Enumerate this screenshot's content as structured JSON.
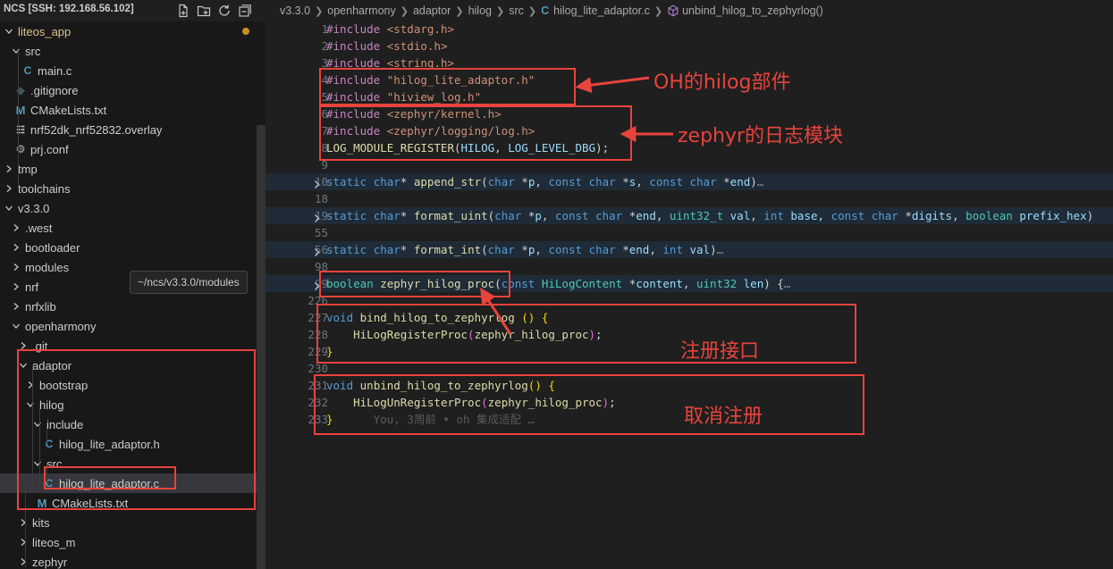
{
  "sidebar": {
    "title": "NCS [SSH: 192.168.56.102]",
    "header_icons": [
      "new-file-icon",
      "new-folder-icon",
      "refresh-icon",
      "collapse-all-icon"
    ],
    "tooltip": "~/ncs/v3.3.0/modules",
    "tree": [
      {
        "label": "liteos_app",
        "kind": "folder",
        "open": true,
        "modified": true
      },
      {
        "label": "src",
        "kind": "folder",
        "open": true
      },
      {
        "label": "main.c",
        "kind": "c"
      },
      {
        "label": ".gitignore",
        "kind": "dot"
      },
      {
        "label": "CMakeLists.txt",
        "kind": "m"
      },
      {
        "label": "nrf52dk_nrf52832.overlay",
        "kind": "brace"
      },
      {
        "label": "prj.conf",
        "kind": "gear"
      },
      {
        "label": "tmp",
        "kind": "folder",
        "open": false
      },
      {
        "label": "toolchains",
        "kind": "folder",
        "open": false
      },
      {
        "label": "v3.3.0",
        "kind": "folder",
        "open": true
      },
      {
        "label": ".west",
        "kind": "folder",
        "open": false
      },
      {
        "label": "bootloader",
        "kind": "folder",
        "open": false
      },
      {
        "label": "modules",
        "kind": "folder",
        "open": false
      },
      {
        "label": "nrf",
        "kind": "folder",
        "open": false
      },
      {
        "label": "nrfxlib",
        "kind": "folder",
        "open": false
      },
      {
        "label": "openharmony",
        "kind": "folder",
        "open": true
      },
      {
        "label": ".git",
        "kind": "folder",
        "open": false
      },
      {
        "label": "adaptor",
        "kind": "folder",
        "open": true
      },
      {
        "label": "bootstrap",
        "kind": "folder",
        "open": false
      },
      {
        "label": "hilog",
        "kind": "folder",
        "open": true
      },
      {
        "label": "include",
        "kind": "folder",
        "open": true
      },
      {
        "label": "hilog_lite_adaptor.h",
        "kind": "c"
      },
      {
        "label": "src",
        "kind": "folder",
        "open": true
      },
      {
        "label": "hilog_lite_adaptor.c",
        "kind": "c",
        "selected": true
      },
      {
        "label": "CMakeLists.txt",
        "kind": "m"
      },
      {
        "label": "kits",
        "kind": "folder",
        "open": false
      },
      {
        "label": "liteos_m",
        "kind": "folder",
        "open": false
      },
      {
        "label": "zephyr",
        "kind": "folder",
        "open": false
      }
    ]
  },
  "breadcrumb": {
    "parts": [
      "v3.3.0",
      "openharmony",
      "adaptor",
      "hilog",
      "src"
    ],
    "file": "hilog_lite_adaptor.c",
    "symbol": "unbind_hilog_to_zephyrlog()",
    "file_icon": "C"
  },
  "code": [
    {
      "ln": "1",
      "tokens": [
        [
          "pre",
          "#include "
        ],
        [
          "inc",
          "<stdarg.h>"
        ]
      ]
    },
    {
      "ln": "2",
      "tokens": [
        [
          "pre",
          "#include "
        ],
        [
          "inc",
          "<stdio.h>"
        ]
      ]
    },
    {
      "ln": "3",
      "tokens": [
        [
          "pre",
          "#include "
        ],
        [
          "inc",
          "<string.h>"
        ]
      ]
    },
    {
      "ln": "4",
      "tokens": [
        [
          "pre",
          "#include "
        ],
        [
          "inc",
          "\"hilog_lite_adaptor.h\""
        ]
      ]
    },
    {
      "ln": "5",
      "tokens": [
        [
          "pre",
          "#include "
        ],
        [
          "inc",
          "\"hiview_log.h\""
        ]
      ]
    },
    {
      "ln": "6",
      "tokens": [
        [
          "pre",
          "#include "
        ],
        [
          "inc",
          "<zephyr/kernel.h>"
        ]
      ]
    },
    {
      "ln": "7",
      "tokens": [
        [
          "pre",
          "#include "
        ],
        [
          "inc",
          "<zephyr/logging/log.h>"
        ]
      ]
    },
    {
      "ln": "8",
      "tokens": [
        [
          "fn",
          "LOG_MODULE_REGISTER"
        ],
        [
          "text",
          "("
        ],
        [
          "par",
          "HILOG"
        ],
        [
          "text",
          ", "
        ],
        [
          "par",
          "LOG_LEVEL_DBG"
        ],
        [
          "text",
          ");"
        ]
      ]
    },
    {
      "ln": "9",
      "tokens": []
    },
    {
      "ln": "10",
      "folded": true,
      "tokens": [
        [
          "kw",
          "static "
        ],
        [
          "kw",
          "char"
        ],
        [
          "text",
          "* "
        ],
        [
          "fn",
          "append_str"
        ],
        [
          "text",
          "("
        ],
        [
          "kw",
          "char "
        ],
        [
          "text",
          "*"
        ],
        [
          "par",
          "p"
        ],
        [
          "text",
          ", "
        ],
        [
          "kw",
          "const char "
        ],
        [
          "text",
          "*"
        ],
        [
          "par",
          "s"
        ],
        [
          "text",
          ", "
        ],
        [
          "kw",
          "const char "
        ],
        [
          "text",
          "*"
        ],
        [
          "par",
          "end"
        ],
        [
          "text",
          ")"
        ],
        [
          "ell",
          "…"
        ]
      ]
    },
    {
      "ln": "18",
      "tokens": []
    },
    {
      "ln": "19",
      "folded": true,
      "tokens": [
        [
          "kw",
          "static "
        ],
        [
          "kw",
          "char"
        ],
        [
          "text",
          "* "
        ],
        [
          "fn",
          "format_uint"
        ],
        [
          "text",
          "("
        ],
        [
          "kw",
          "char "
        ],
        [
          "text",
          "*"
        ],
        [
          "par",
          "p"
        ],
        [
          "text",
          ", "
        ],
        [
          "kw",
          "const char "
        ],
        [
          "text",
          "*"
        ],
        [
          "par",
          "end"
        ],
        [
          "text",
          ", "
        ],
        [
          "type",
          "uint32_t "
        ],
        [
          "par",
          "val"
        ],
        [
          "text",
          ", "
        ],
        [
          "kw",
          "int "
        ],
        [
          "par",
          "base"
        ],
        [
          "text",
          ", "
        ],
        [
          "kw",
          "const char "
        ],
        [
          "text",
          "*"
        ],
        [
          "par",
          "digits"
        ],
        [
          "text",
          ", "
        ],
        [
          "type",
          "boolean "
        ],
        [
          "par",
          "prefix_hex"
        ],
        [
          "text",
          ")"
        ]
      ]
    },
    {
      "ln": "55",
      "tokens": []
    },
    {
      "ln": "56",
      "folded": true,
      "tokens": [
        [
          "kw",
          "static "
        ],
        [
          "kw",
          "char"
        ],
        [
          "text",
          "* "
        ],
        [
          "fn",
          "format_int"
        ],
        [
          "text",
          "("
        ],
        [
          "kw",
          "char "
        ],
        [
          "text",
          "*"
        ],
        [
          "par",
          "p"
        ],
        [
          "text",
          ", "
        ],
        [
          "kw",
          "const char "
        ],
        [
          "text",
          "*"
        ],
        [
          "par",
          "end"
        ],
        [
          "text",
          ", "
        ],
        [
          "kw",
          "int "
        ],
        [
          "par",
          "val"
        ],
        [
          "text",
          ")"
        ],
        [
          "ell",
          "…"
        ]
      ]
    },
    {
      "ln": "98",
      "tokens": []
    },
    {
      "ln": "99",
      "folded": true,
      "tokens": [
        [
          "type",
          "boolean "
        ],
        [
          "fn",
          "zephyr_hilog_proc"
        ],
        [
          "text",
          "("
        ],
        [
          "kw",
          "const "
        ],
        [
          "type",
          "HiLogContent "
        ],
        [
          "text",
          "*"
        ],
        [
          "par",
          "content"
        ],
        [
          "text",
          ", "
        ],
        [
          "type",
          "uint32 "
        ],
        [
          "par",
          "len"
        ],
        [
          "text",
          ") {"
        ],
        [
          "ell",
          "…"
        ]
      ]
    },
    {
      "ln": "226",
      "tokens": []
    },
    {
      "ln": "227",
      "tokens": [
        [
          "kw",
          "void "
        ],
        [
          "fn",
          "bind_hilog_to_zephyrlog "
        ],
        [
          "brk",
          "()"
        ],
        [
          "text",
          " "
        ],
        [
          "brk",
          "{"
        ]
      ]
    },
    {
      "ln": "228",
      "tokens": [
        [
          "text",
          "    "
        ],
        [
          "fn",
          "HiLogRegisterProc"
        ],
        [
          "brk2",
          "("
        ],
        [
          "fn",
          "zephyr_hilog_proc"
        ],
        [
          "brk2",
          ")"
        ],
        [
          "text",
          ";"
        ]
      ]
    },
    {
      "ln": "229",
      "tokens": [
        [
          "brk",
          "}"
        ]
      ]
    },
    {
      "ln": "230",
      "tokens": []
    },
    {
      "ln": "231",
      "tokens": [
        [
          "kw",
          "void "
        ],
        [
          "fn",
          "unbind_hilog_to_zephyrlog"
        ],
        [
          "brk",
          "()"
        ],
        [
          "text",
          " "
        ],
        [
          "brk",
          "{"
        ]
      ]
    },
    {
      "ln": "232",
      "tokens": [
        [
          "text",
          "    "
        ],
        [
          "fn",
          "HiLogUnRegisterProc"
        ],
        [
          "brk2",
          "("
        ],
        [
          "fn",
          "zephyr_hilog_proc"
        ],
        [
          "brk2",
          ")"
        ],
        [
          "text",
          ";"
        ]
      ]
    },
    {
      "ln": "233",
      "tokens": [
        [
          "brk",
          "}"
        ],
        [
          "blame",
          "      You, 3周前 • oh 集成适配 …"
        ]
      ]
    }
  ],
  "annotations": {
    "oh_hilog": "OH的hilog部件",
    "zephyr_log": "zephyr的日志模块",
    "register": "注册接口",
    "unregister": "取消注册"
  },
  "colors": {
    "annotation": "#e8433d",
    "folder_open": "#e2c08d",
    "c_icon": "#519aba",
    "modified_dot": "#c69026"
  }
}
